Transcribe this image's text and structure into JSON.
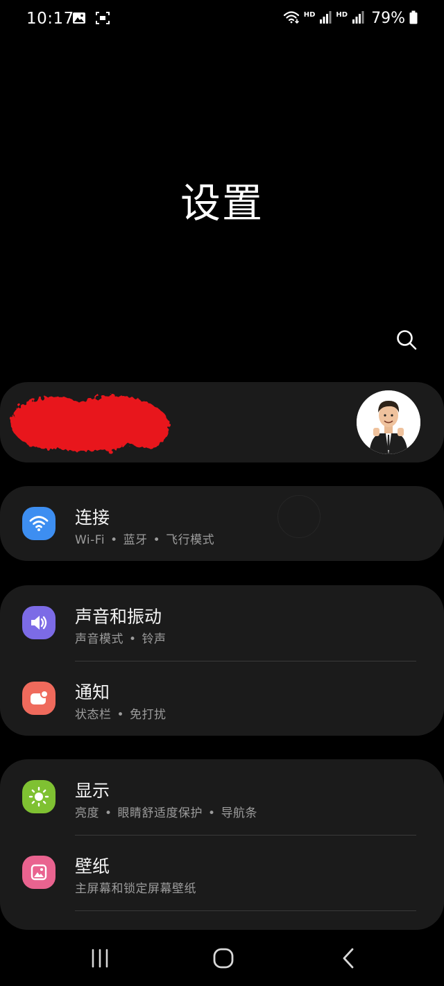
{
  "status_bar": {
    "time": "10:17",
    "battery": "79%",
    "hd_label_1": "HD",
    "hd_label_2": "HD",
    "left_icons": [
      "image-icon",
      "screenshot-icon"
    ],
    "right_icons": [
      "wifi-icon",
      "signal-icon",
      "signal-icon",
      "battery-icon"
    ]
  },
  "header": {
    "title": "设置",
    "search_icon": "search-icon"
  },
  "account": {
    "avatar_icon": "avatar-icon"
  },
  "groups": [
    {
      "items": [
        {
          "title": "连接",
          "subtitle_parts": [
            "Wi-Fi",
            "蓝牙",
            "飞行模式"
          ],
          "icon": "wifi-icon",
          "color": "#3d8ef1"
        }
      ]
    },
    {
      "items": [
        {
          "title": "声音和振动",
          "subtitle_parts": [
            "声音模式",
            "铃声"
          ],
          "icon": "volume-icon",
          "color": "#7c6be6"
        },
        {
          "title": "通知",
          "subtitle_parts": [
            "状态栏",
            "免打扰"
          ],
          "icon": "notification-icon",
          "color": "#ef6a5c"
        }
      ]
    },
    {
      "items": [
        {
          "title": "显示",
          "subtitle_parts": [
            "亮度",
            "眼睛舒适度保护",
            "导航条"
          ],
          "icon": "sun-icon",
          "color": "#7fc132"
        },
        {
          "title": "壁纸",
          "subtitle_parts": [
            "主屏幕和锁定屏幕壁纸"
          ],
          "icon": "image-icon",
          "color": "#e9638f"
        }
      ]
    }
  ],
  "nav_bar": {
    "icons": [
      "recents-icon",
      "home-icon",
      "back-icon"
    ]
  },
  "colors": {
    "background": "#000000",
    "card": "#1b1b1b",
    "subtitle": "#9c9c9c"
  }
}
